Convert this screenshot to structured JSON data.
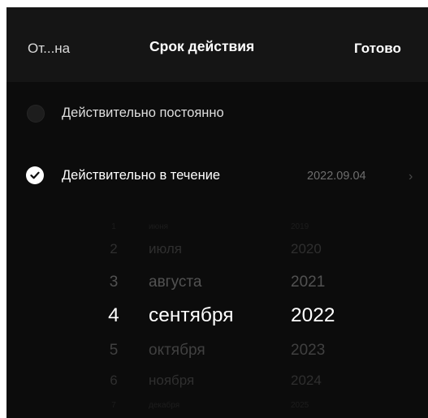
{
  "header": {
    "cancel_label": "От...на",
    "title": "Срок действия",
    "done_label": "Готово"
  },
  "options": [
    {
      "label": "Действительно постоянно",
      "selected": false
    },
    {
      "label": "Действительно в течение",
      "selected": true,
      "value": "2022.09.04",
      "chevron": "›"
    }
  ],
  "picker": {
    "days": [
      "1",
      "2",
      "3",
      "4",
      "5",
      "6",
      "7"
    ],
    "months": [
      "июня",
      "июля",
      "августа",
      "сентября",
      "октября",
      "ноября",
      "декабря"
    ],
    "years": [
      "2019",
      "2020",
      "2021",
      "2022",
      "2023",
      "2024",
      "2025"
    ],
    "selected_index": 3
  },
  "colors": {
    "background": "#0c0c0c",
    "header_background": "#151515",
    "selected_text": "#ffffff",
    "secondary_text": "#6e6e6e"
  },
  "icons": {
    "check": "checkmark-icon",
    "chevron": "chevron-right-icon"
  }
}
